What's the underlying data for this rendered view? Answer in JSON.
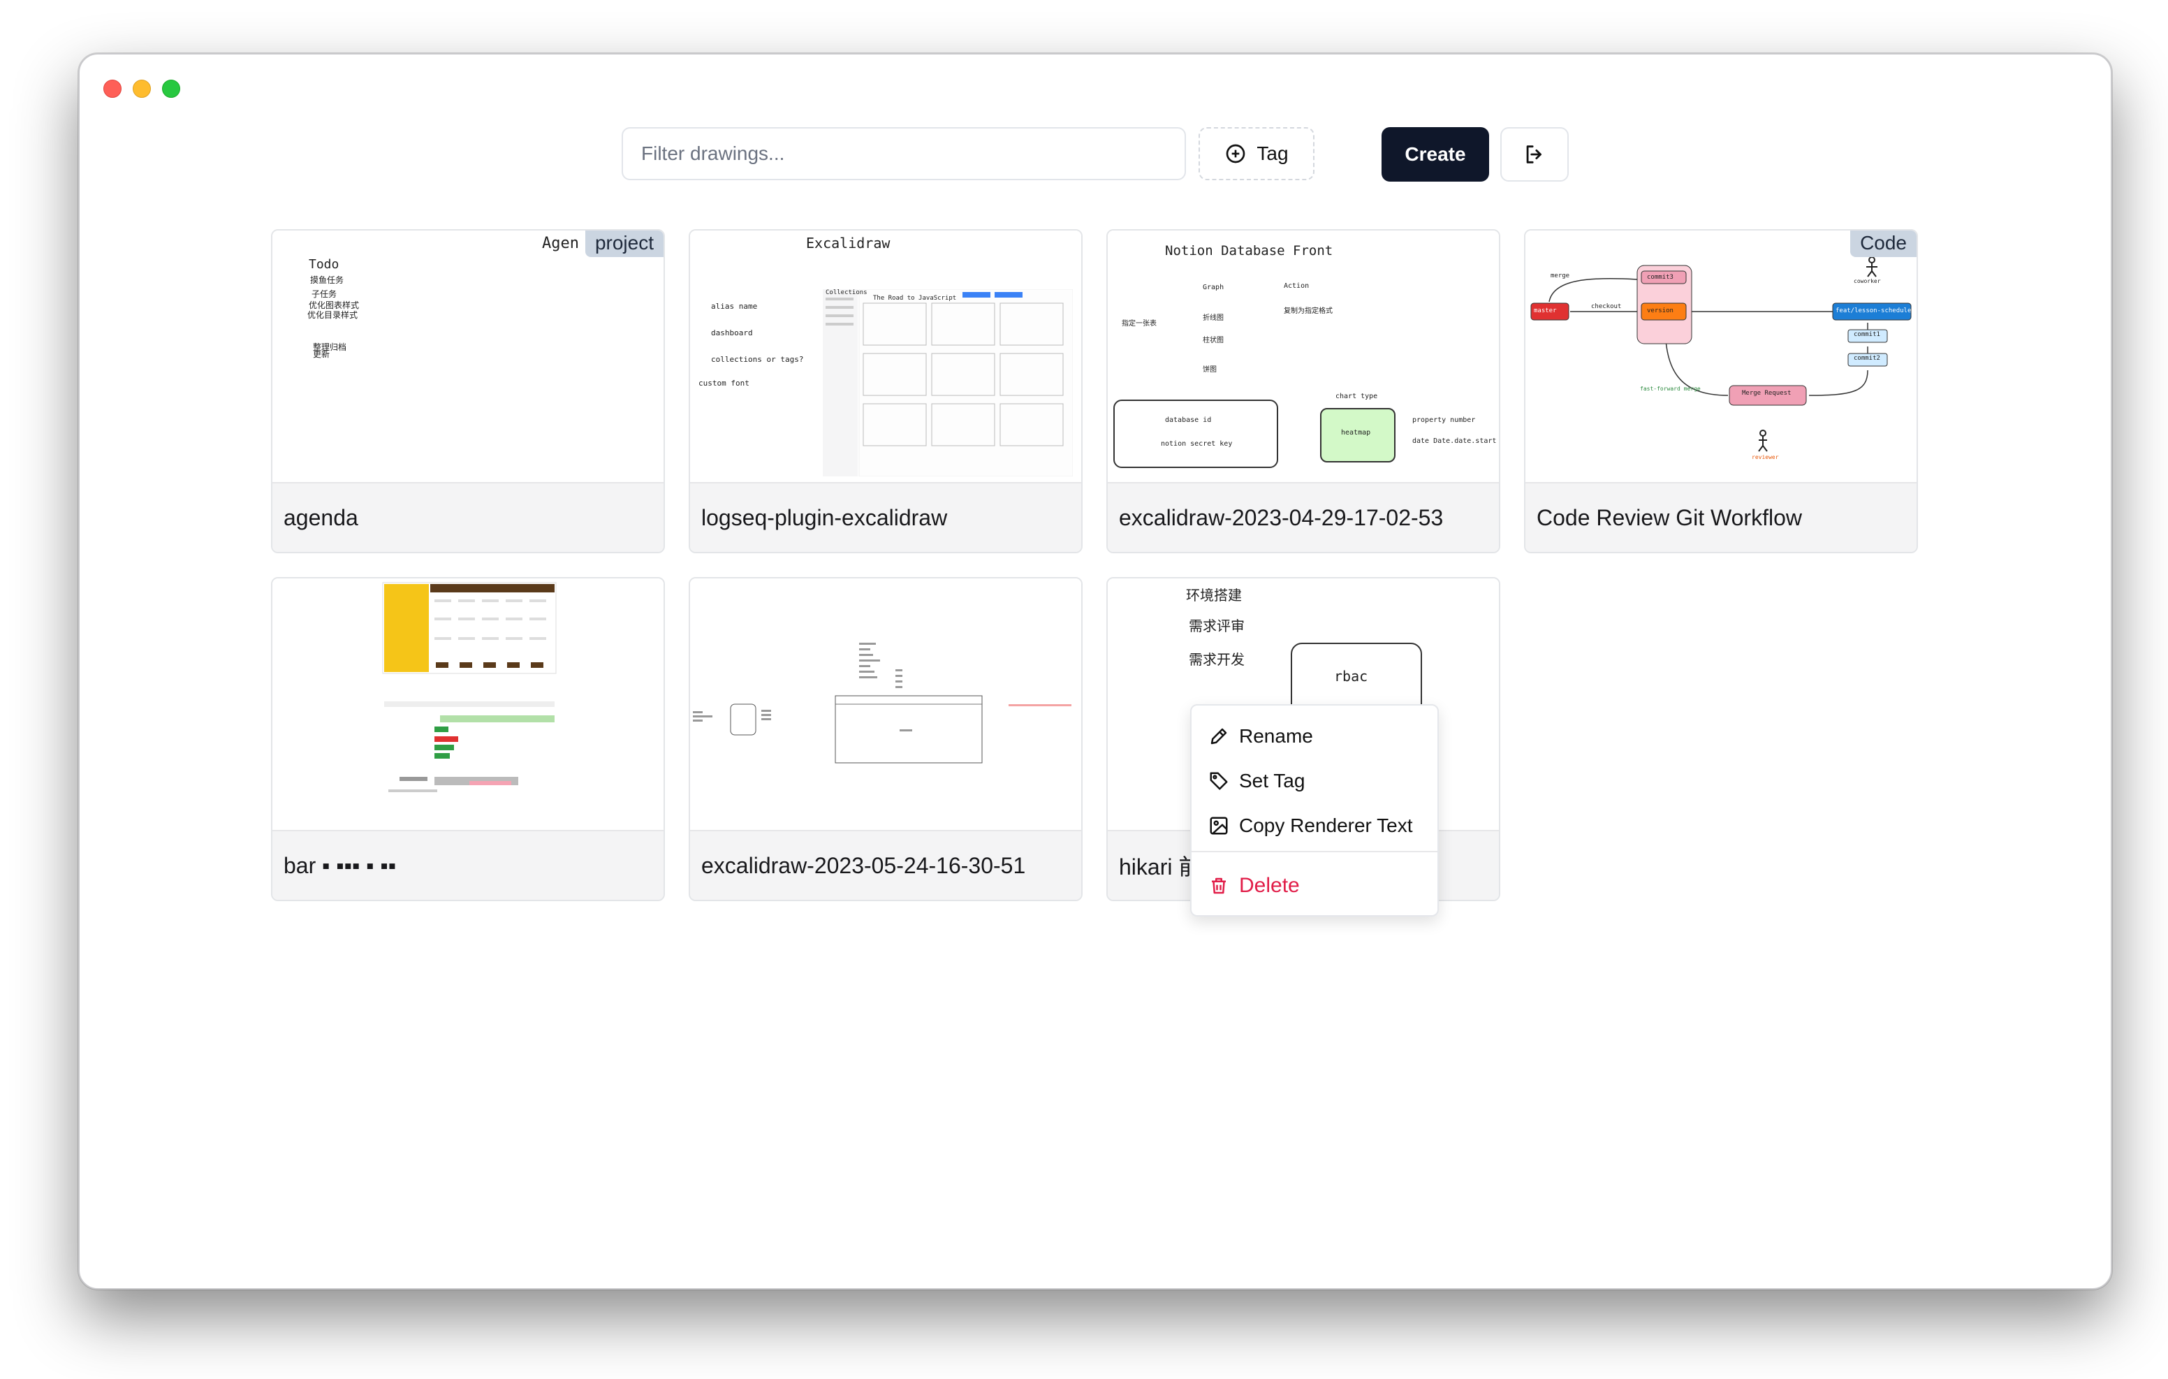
{
  "toolbar": {
    "filter_placeholder": "Filter drawings...",
    "tag_label": "Tag",
    "create_label": "Create"
  },
  "cards": [
    {
      "title": "agenda",
      "badge": "project",
      "sketch": [
        "Agen",
        "Todo",
        "摸鱼任务",
        "子任务",
        "优化图表样式",
        "优化目录样式",
        "整理归档",
        "更新"
      ]
    },
    {
      "title": "logseq-plugin-excalidraw",
      "sketch": [
        "Excalidraw",
        "alias name",
        "dashboard",
        "collections or tags?",
        "custom font",
        "Collections",
        "The Road to JavaScript"
      ]
    },
    {
      "title": "excalidraw-2023-04-29-17-02-53",
      "sketch": [
        "Notion Database Front",
        "Graph",
        "Action",
        "折线图",
        "复制为指定格式",
        "指定一张表",
        "柱状图",
        "饼图",
        "chart type",
        "database id",
        "heatmap",
        "property number",
        "notion secret key",
        "date Date.date.start"
      ]
    },
    {
      "title": "Code Review Git Workflow",
      "badge": "Code",
      "sketch": [
        "master",
        "version",
        "commit3",
        "feat/lesson-schedule",
        "commit1",
        "commit2",
        "Merge Request",
        "merge",
        "checkout",
        "fast-forward merge",
        "coworker",
        "reviewer"
      ]
    },
    {
      "title": "bar ▪ ▪▪▪ ▪ ▪▪"
    },
    {
      "title": "excalidraw-2023-05-24-16-30-51"
    },
    {
      "title": "hikari 前",
      "sketch": [
        "环境搭建",
        "需求评审",
        "需求开发",
        "rbac"
      ]
    }
  ],
  "context_menu": {
    "items": [
      {
        "label": "Rename",
        "icon": "pencil-icon"
      },
      {
        "label": "Set Tag",
        "icon": "tag-icon"
      },
      {
        "label": "Copy Renderer Text",
        "icon": "image-icon"
      }
    ],
    "delete_label": "Delete"
  }
}
